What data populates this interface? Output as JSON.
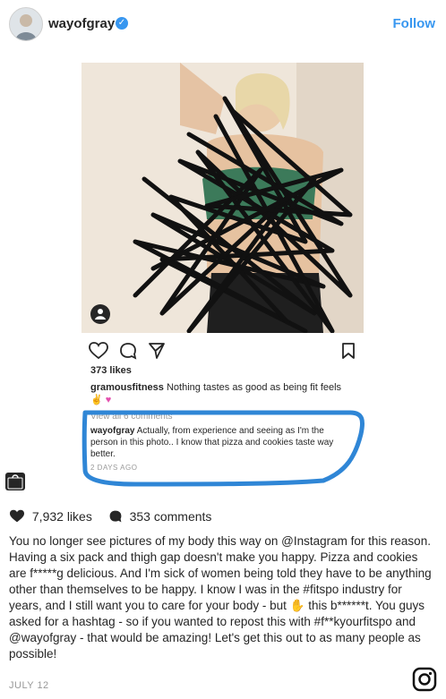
{
  "header": {
    "username": "wayofgray",
    "verified_mark": "✓",
    "follow_label": "Follow"
  },
  "embed": {
    "likes": "373 likes",
    "caption_user": "gramousfitness",
    "caption_text": "Nothing tastes as good as being fit feels",
    "view_all": "View all 6 comments",
    "comment_user": "wayofgray",
    "comment_text": "Actually, from experience and seeing as I'm the person in this photo.. I know that pizza and cookies taste way better.",
    "time_ago": "2 DAYS AGO"
  },
  "post": {
    "likes_count": "7,932 likes",
    "comments_count": "353 comments",
    "caption": "You no longer see pictures of my body this way on @Instagram for this reason. Having a six pack and thigh gap doesn't make you happy. Pizza and cookies are f*****g delicious. And I'm sick of women being told they have to be anything other than themselves to be happy. I know I was in the #fitspo industry for years, and I still want you to care for your body - but ✋ this b******t. You guys asked for a hashtag - so if you wanted to repost this with #f**kyourfitspo and @wayofgray - that would be amazing! Let's get this out to as many people as possible!",
    "date": "JULY 12"
  },
  "colors": {
    "accent": "#3897f0",
    "highlight": "#2f86d6",
    "scribble": "#111111"
  },
  "icons": [
    "verified-icon",
    "person-tag-icon",
    "heart-icon",
    "comment-icon",
    "share-icon",
    "bookmark-icon",
    "shopping-bag-icon",
    "instagram-icon"
  ]
}
